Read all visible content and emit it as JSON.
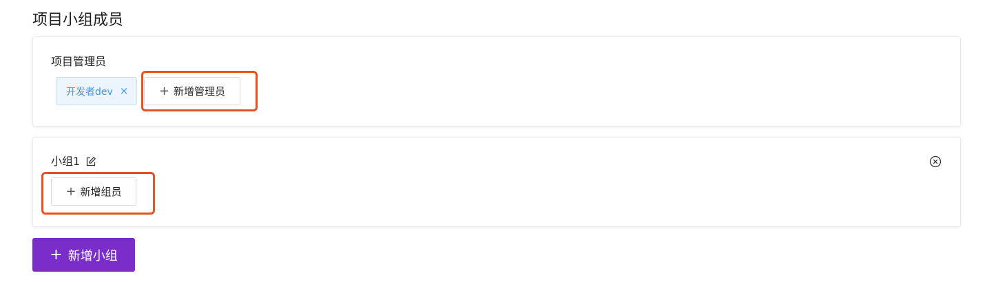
{
  "section": {
    "title": "项目小组成员"
  },
  "managers": {
    "label": "项目管理员",
    "tags": [
      {
        "label": "开发者dev",
        "close_glyph": "×"
      }
    ],
    "add_button": {
      "icon": "plus-icon",
      "label": "新增管理员"
    }
  },
  "group": {
    "name": "小组1",
    "edit_icon": "edit-icon",
    "remove_icon": "close-circle-icon",
    "add_member_button": {
      "icon": "plus-icon",
      "label": "新增组员"
    }
  },
  "add_group_button": {
    "icon": "plus-icon",
    "label": "新增小组"
  },
  "colors": {
    "primary": "#7b2dc9",
    "highlight": "#e8501f",
    "tag_text": "#3a9ae6",
    "tag_bg": "#ecf5fd"
  }
}
